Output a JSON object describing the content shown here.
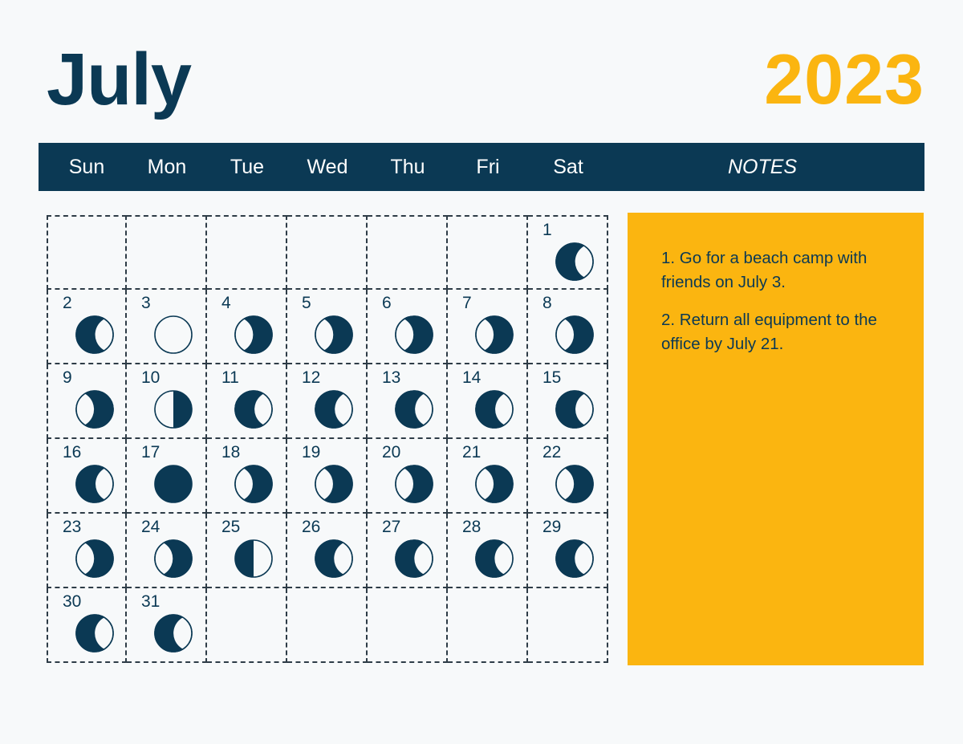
{
  "header": {
    "month": "July",
    "year": "2023",
    "month_color": "#0b3954",
    "year_color": "#fbb510"
  },
  "weekdays": [
    {
      "short": "Sun"
    },
    {
      "short": "Mon"
    },
    {
      "short": "Tue"
    },
    {
      "short": "Wed"
    },
    {
      "short": "Thu"
    },
    {
      "short": "Fri"
    },
    {
      "short": "Sat"
    }
  ],
  "notes_header": "NOTES",
  "notes": [
    "1. Go for a beach camp with friends on July 3.",
    "2. Return all equipment to the office by July 21."
  ],
  "theme": {
    "background": "#f7f9fa",
    "ink": "#0b3954",
    "accent": "#fbb510",
    "grid_line": "#2e3c47",
    "moon_dark": "#0b3954",
    "moon_light": "#f7f9fa"
  },
  "calendar": {
    "month": "July",
    "year": 2023,
    "first_weekday_index": 6,
    "days_in_month": 31,
    "rows": 6,
    "cells": [
      {
        "day": null,
        "phase": null,
        "illumination": null
      },
      {
        "day": null,
        "phase": null,
        "illumination": null
      },
      {
        "day": null,
        "phase": null,
        "illumination": null
      },
      {
        "day": null,
        "phase": null,
        "illumination": null
      },
      {
        "day": null,
        "phase": null,
        "illumination": null
      },
      {
        "day": null,
        "phase": null,
        "illumination": null
      },
      {
        "day": "1",
        "phase": "waning-crescent",
        "illumination": 0.3,
        "dark_side": "left"
      },
      {
        "day": "2",
        "phase": "waning-crescent",
        "illumination": 0.33,
        "dark_side": "left"
      },
      {
        "day": "3",
        "phase": "new-moon",
        "illumination": 0.0,
        "dark_side": "none"
      },
      {
        "day": "4",
        "phase": "waxing-crescent",
        "illumination": 0.3,
        "dark_side": "right"
      },
      {
        "day": "5",
        "phase": "waxing-crescent",
        "illumination": 0.27,
        "dark_side": "right"
      },
      {
        "day": "6",
        "phase": "waxing-crescent",
        "illumination": 0.25,
        "dark_side": "right"
      },
      {
        "day": "7",
        "phase": "waxing-crescent",
        "illumination": 0.22,
        "dark_side": "right"
      },
      {
        "day": "8",
        "phase": "waxing-crescent",
        "illumination": 0.2,
        "dark_side": "right"
      },
      {
        "day": "9",
        "phase": "waxing-crescent",
        "illumination": 0.22,
        "dark_side": "right"
      },
      {
        "day": "10",
        "phase": "last-quarter",
        "illumination": 0.5,
        "dark_side": "right"
      },
      {
        "day": "11",
        "phase": "waning-crescent",
        "illumination": 0.15,
        "dark_side": "left"
      },
      {
        "day": "12",
        "phase": "waning-crescent",
        "illumination": 0.13,
        "dark_side": "left"
      },
      {
        "day": "13",
        "phase": "waning-crescent",
        "illumination": 0.15,
        "dark_side": "left"
      },
      {
        "day": "14",
        "phase": "waning-crescent",
        "illumination": 0.17,
        "dark_side": "left"
      },
      {
        "day": "15",
        "phase": "waning-crescent",
        "illumination": 0.18,
        "dark_side": "left"
      },
      {
        "day": "16",
        "phase": "waning-crescent",
        "illumination": 0.18,
        "dark_side": "left"
      },
      {
        "day": "17",
        "phase": "full-dark",
        "illumination": 1.0,
        "dark_side": "all"
      },
      {
        "day": "18",
        "phase": "waxing-crescent",
        "illumination": 0.18,
        "dark_side": "right"
      },
      {
        "day": "19",
        "phase": "waxing-crescent",
        "illumination": 0.18,
        "dark_side": "right"
      },
      {
        "day": "20",
        "phase": "waxing-crescent",
        "illumination": 0.2,
        "dark_side": "right"
      },
      {
        "day": "21",
        "phase": "waxing-crescent",
        "illumination": 0.22,
        "dark_side": "right"
      },
      {
        "day": "22",
        "phase": "waxing-crescent",
        "illumination": 0.24,
        "dark_side": "right"
      },
      {
        "day": "23",
        "phase": "waxing-crescent",
        "illumination": 0.26,
        "dark_side": "right"
      },
      {
        "day": "24",
        "phase": "waxing-crescent",
        "illumination": 0.28,
        "dark_side": "right"
      },
      {
        "day": "25",
        "phase": "first-quarter",
        "illumination": 0.5,
        "dark_side": "left"
      },
      {
        "day": "26",
        "phase": "waning-gibbous",
        "illumination": 0.42,
        "dark_side": "left"
      },
      {
        "day": "27",
        "phase": "waning-gibbous",
        "illumination": 0.4,
        "dark_side": "left"
      },
      {
        "day": "28",
        "phase": "waning-gibbous",
        "illumination": 0.38,
        "dark_side": "left"
      },
      {
        "day": "29",
        "phase": "waning-gibbous",
        "illumination": 0.42,
        "dark_side": "left"
      },
      {
        "day": "30",
        "phase": "waning-gibbous",
        "illumination": 0.45,
        "dark_side": "left"
      },
      {
        "day": "31",
        "phase": "waning-gibbous",
        "illumination": 0.45,
        "dark_side": "left"
      },
      {
        "day": null,
        "phase": null,
        "illumination": null
      },
      {
        "day": null,
        "phase": null,
        "illumination": null
      },
      {
        "day": null,
        "phase": null,
        "illumination": null
      },
      {
        "day": null,
        "phase": null,
        "illumination": null
      },
      {
        "day": null,
        "phase": null,
        "illumination": null
      }
    ]
  }
}
